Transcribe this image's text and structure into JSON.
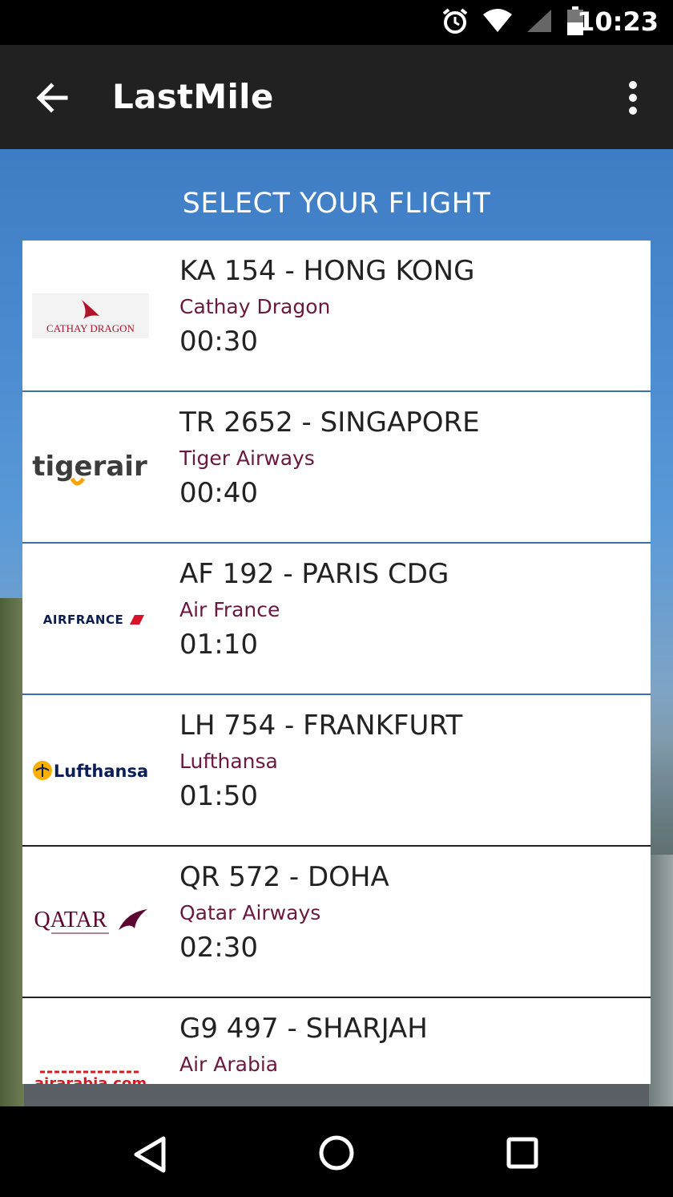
{
  "status_bar": {
    "time": "10:23",
    "icons": [
      "alarm-icon",
      "wifi-icon",
      "signal-icon",
      "battery-icon"
    ]
  },
  "app_bar": {
    "title": "LastMile",
    "back_icon": "arrow-back-icon",
    "menu_icon": "more-vert-icon"
  },
  "page": {
    "heading": "SELECT YOUR FLIGHT"
  },
  "flights": [
    {
      "title": "KA 154 - HONG KONG",
      "airline": "Cathay Dragon",
      "time": "00:30",
      "logo_text": "CATHAY DRAGON"
    },
    {
      "title": "TR 2652 - SINGAPORE",
      "airline": "Tiger Airways",
      "time": "00:40",
      "logo_text": "tigerair"
    },
    {
      "title": "AF 192 - PARIS CDG",
      "airline": "Air France",
      "time": "01:10",
      "logo_text": "AIRFRANCE"
    },
    {
      "title": "LH 754 - FRANKFURT",
      "airline": "Lufthansa",
      "time": "01:50",
      "logo_text": "Lufthansa"
    },
    {
      "title": "QR 572 - DOHA",
      "airline": "Qatar Airways",
      "time": "02:30",
      "logo_text": "QATAR"
    },
    {
      "title": "G9 497 - SHARJAH",
      "airline": "Air Arabia",
      "time": "",
      "logo_text": "airarabia.com"
    }
  ],
  "colors": {
    "app_bar": "#212121",
    "airline_name": "#6a1840",
    "card_border": "#3a6fb0"
  },
  "nav_bar": {
    "icons": [
      "back-triangle-icon",
      "home-circle-icon",
      "recents-square-icon"
    ]
  }
}
